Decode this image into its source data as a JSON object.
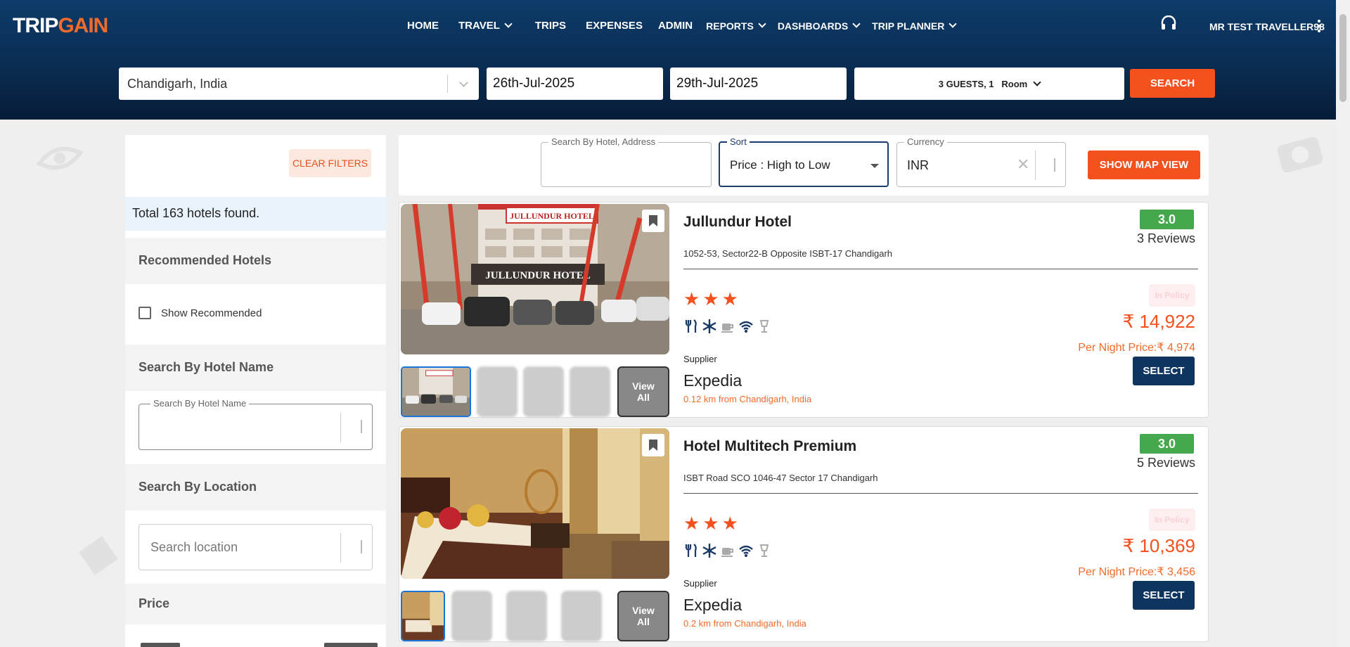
{
  "brand": {
    "trip": "TRIP",
    "gain": "GAIN"
  },
  "nav": {
    "home": "HOME",
    "travel": "TRAVEL",
    "trips": "TRIPS",
    "expenses": "EXPENSES",
    "admin": "ADMIN",
    "reports": "REPORTS",
    "dashboards": "DASHBOARDS",
    "trip_planner": "TRIP PLANNER"
  },
  "user": {
    "name": "MR TEST TRAVELLER98"
  },
  "search": {
    "destination": "Chandigarh, India",
    "checkin": "26th-Jul-2025",
    "checkout": "29th-Jul-2025",
    "guests": "3 GUESTS, 1",
    "rooms": "Room",
    "button": "SEARCH"
  },
  "sidebar": {
    "clear_filters": "CLEAR FILTERS",
    "total": "Total 163 hotels found.",
    "recommended_heading": "Recommended Hotels",
    "show_recommended": "Show Recommended",
    "hotel_name_heading": "Search By Hotel Name",
    "hotel_name_legend": "Search By Hotel Name",
    "location_heading": "Search By Location",
    "location_placeholder": "Search location",
    "price_heading": "Price"
  },
  "filters": {
    "hotel_search_legend": "Search By Hotel, Address",
    "sort_legend": "Sort",
    "sort_value": "Price : High to Low",
    "currency_legend": "Currency",
    "currency_value": "INR",
    "map_button": "SHOW MAP VIEW"
  },
  "hotels": [
    {
      "name": "Jullundur Hotel",
      "address": "1052-53, Sector22-B Opposite ISBT-17 Chandigarh",
      "rating": "3.0",
      "reviews": "3 Reviews",
      "stars": 3,
      "policy": "In Policy",
      "price": "₹ 14,922",
      "per_night": "Per Night Price:₹ 4,974",
      "supplier_label": "Supplier",
      "supplier": "Expedia",
      "distance": "0.12 km from Chandigarh, India",
      "select": "SELECT",
      "view_all": "View All",
      "sign_text": "JULLUNDUR HOTEL"
    },
    {
      "name": "Hotel Multitech Premium",
      "address": "ISBT Road SCO 1046-47 Sector 17 Chandigarh",
      "rating": "3.0",
      "reviews": "5 Reviews",
      "stars": 3,
      "policy": "In Policy",
      "price": "₹ 10,369",
      "per_night": "Per Night Price:₹ 3,456",
      "supplier_label": "Supplier",
      "supplier": "Expedia",
      "distance": "0.2 km from Chandigarh, India",
      "select": "SELECT",
      "view_all": "View All"
    }
  ],
  "icons": {
    "support": "headset-icon",
    "menu": "kebab-menu-icon",
    "bookmark": "bookmark-icon",
    "amenities": [
      "restaurant-icon",
      "ac-snowflake-icon",
      "coffee-icon",
      "wifi-icon",
      "bar-glass-icon"
    ]
  },
  "colors": {
    "header": "#0a2d52",
    "accent": "#f4511e",
    "rating": "#46a84c",
    "select": "#0e3560"
  }
}
